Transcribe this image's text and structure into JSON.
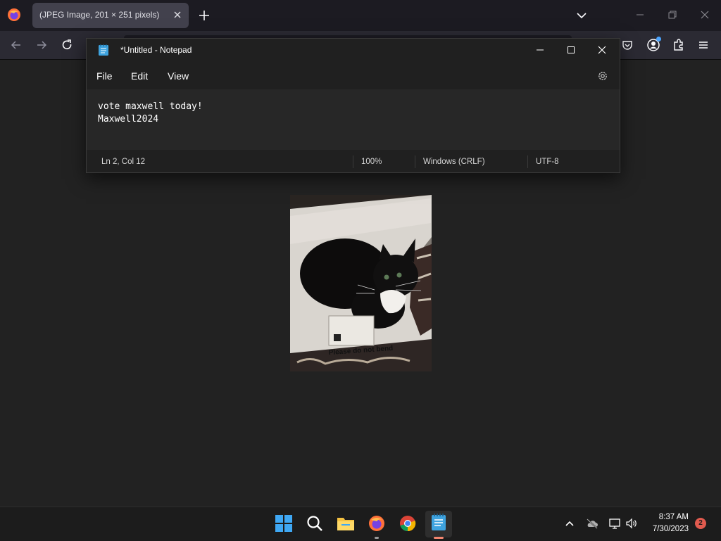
{
  "browser": {
    "tab_title": "(JPEG Image, 201 × 251 pixels)",
    "accent": "#42414d"
  },
  "image_viewer": {
    "caption": "Please do not bend",
    "alt": "Black and white cat sitting on paper"
  },
  "notepad": {
    "title": "*Untitled - Notepad",
    "menu": [
      "File",
      "Edit",
      "View"
    ],
    "content_lines": [
      "vote maxwell today!",
      "Maxwell2024"
    ],
    "status": {
      "position": "Ln 2, Col 12",
      "zoom": "100%",
      "line_ending": "Windows (CRLF)",
      "encoding": "UTF-8"
    }
  },
  "taskbar": {
    "apps": [
      "start-icon",
      "search-icon",
      "file-explorer-icon",
      "firefox-icon",
      "chrome-icon",
      "notepad-icon"
    ],
    "time": "8:37 AM",
    "date": "7/30/2023",
    "notification_count": "2"
  }
}
